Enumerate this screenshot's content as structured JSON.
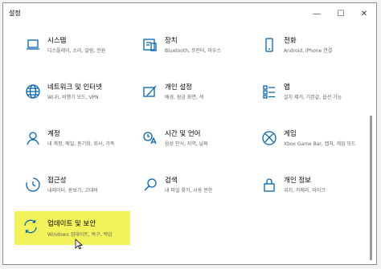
{
  "window": {
    "title": "설정",
    "minimize": "—",
    "maximize": "☐",
    "close": "✕"
  },
  "tiles": [
    {
      "name": "시스템",
      "desc": "디스플레이, 소리, 알림, 전원",
      "icon": "laptop-icon"
    },
    {
      "name": "장치",
      "desc": "Bluetooth, 프린터, 마우스",
      "icon": "devices-icon"
    },
    {
      "name": "전화",
      "desc": "Android, iPhone 연결",
      "icon": "phone-icon"
    },
    {
      "name": "네트워크 및 인터넷",
      "desc": "Wi-Fi, 비행기 모드, VPN",
      "icon": "globe-icon"
    },
    {
      "name": "개인 설정",
      "desc": "배경, 잠금 화면, 색",
      "icon": "paintbrush-icon"
    },
    {
      "name": "앱",
      "desc": "설치 제거, 기본값, 옵션 기능",
      "icon": "apps-icon"
    },
    {
      "name": "계정",
      "desc": "내 계정, 메일, 동기화, 회사, 가족",
      "icon": "person-icon"
    },
    {
      "name": "시간 및 언어",
      "desc": "음성 인식, 지역, 날짜",
      "icon": "time-language-icon"
    },
    {
      "name": "게임",
      "desc": "Xbox Game Bar, 캡처, 게임 모드",
      "icon": "xbox-icon"
    },
    {
      "name": "접근성",
      "desc": "내레이터, 돋보기, 고대비",
      "icon": "accessibility-icon"
    },
    {
      "name": "검색",
      "desc": "내 파일 찾기, 사용 권한",
      "icon": "search-icon"
    },
    {
      "name": "개인 정보",
      "desc": "위치, 카메라, 마이크",
      "icon": "lock-icon"
    },
    {
      "name": "업데이트 및 보안",
      "desc": "Windows 업데이트, 복구, 백업",
      "icon": "update-icon",
      "highlighted": true
    }
  ],
  "colors": {
    "accent": "#0063b1",
    "highlight": "#f2f35a"
  }
}
